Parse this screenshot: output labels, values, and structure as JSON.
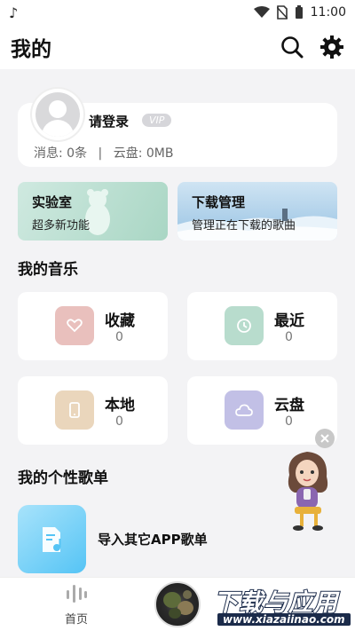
{
  "status_bar": {
    "time": "11:00",
    "icons": [
      "music-note-icon",
      "wifi-icon",
      "no-sim-icon",
      "battery-icon"
    ]
  },
  "header": {
    "title": "我的",
    "icons": [
      "search-icon",
      "gear-icon"
    ]
  },
  "profile": {
    "login_text": "请登录",
    "vip_badge": "VIP",
    "messages": "消息: 0条",
    "separator": "|",
    "cloud": "云盘: 0MB"
  },
  "banners": [
    {
      "title": "实验室",
      "subtitle": "超多新功能"
    },
    {
      "title": "下载管理",
      "subtitle": "管理正在下载的歌曲"
    }
  ],
  "my_music": {
    "title": "我的音乐",
    "tiles": [
      {
        "label": "收藏",
        "count": "0",
        "icon": "heart-icon",
        "color": "#e9c0bd"
      },
      {
        "label": "最近",
        "count": "0",
        "icon": "clock-icon",
        "color": "#b8dccd"
      },
      {
        "label": "本地",
        "count": "0",
        "icon": "phone-icon",
        "color": "#ead6bc"
      },
      {
        "label": "云盘",
        "count": "0",
        "icon": "cloud-icon",
        "color": "#c2c0e6"
      }
    ]
  },
  "playlists": {
    "title": "我的个性歌单",
    "import_label": "导入其它APP歌单",
    "import_icon": "music-file-icon"
  },
  "bottom_nav": {
    "home_label": "首页",
    "home_icon": "audio-bars-icon",
    "player_icon": "album-art"
  },
  "watermark": {
    "brand": "下载与应用",
    "url": "www.xiazaiinao.com"
  }
}
